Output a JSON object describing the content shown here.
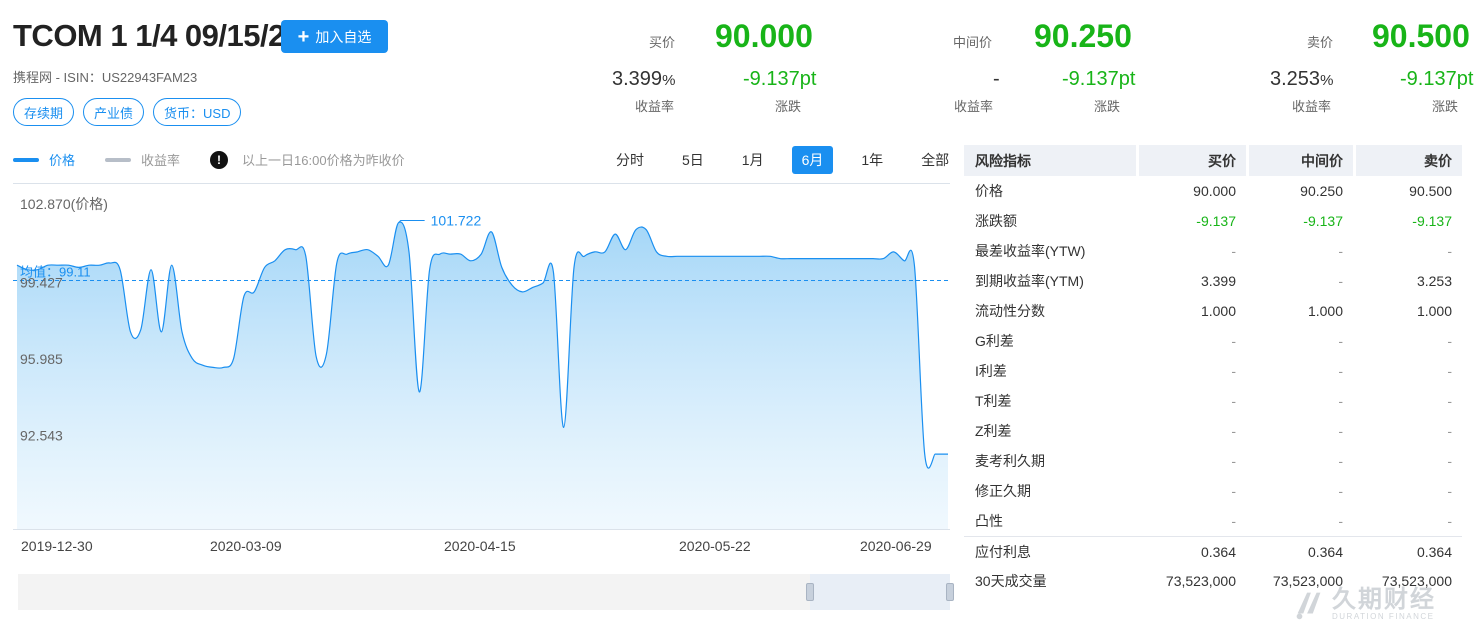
{
  "bond": {
    "title": "TCOM 1 1/4 09/15/22",
    "issuer_line": "携程网 - ISIN：US22943FAM23",
    "tags": [
      "存续期",
      "产业债",
      "货币：USD"
    ]
  },
  "watchlist_label": "加入自选",
  "quotes": {
    "bid": {
      "label": "买价",
      "price": "90.000",
      "yield": "3.399",
      "yield_unit": "%",
      "change": "-9.137pt",
      "yield_label": "收益率",
      "change_label": "涨跌"
    },
    "mid": {
      "label": "中间价",
      "price": "90.250",
      "yield": "-",
      "yield_unit": "",
      "change": "-9.137pt",
      "yield_label": "收益率",
      "change_label": "涨跌"
    },
    "ask": {
      "label": "卖价",
      "price": "90.500",
      "yield": "3.253",
      "yield_unit": "%",
      "change": "-9.137pt",
      "yield_label": "收益率",
      "change_label": "涨跌"
    }
  },
  "legend": {
    "price": "价格",
    "yield": "收益率",
    "info_symbol": "!",
    "note": "以上一日16:00价格为昨收价",
    "price_color": "#1a8ff0",
    "yield_color": "#b7bec8"
  },
  "periods": [
    "分时",
    "5日",
    "1月",
    "6月",
    "1年",
    "全部"
  ],
  "active_period": "6月",
  "chart_data": {
    "type": "area",
    "y_axis_label": "102.870(价格)",
    "y_ticks": [
      "99.427",
      "95.985",
      "92.543"
    ],
    "ylim": [
      89.1,
      102.87
    ],
    "x_ticks": [
      "2019-12-30",
      "2020-03-09",
      "2020-04-15",
      "2020-05-22",
      "2020-06-29"
    ],
    "average_label": "均值：99.11",
    "average": 99.11,
    "max_label": "101.722",
    "max": 101.722,
    "series": [
      {
        "values": [
          99.8,
          99.6,
          99.6,
          99.8,
          99.8,
          99.8,
          99.7,
          99.8,
          99.8,
          99.9,
          99.6,
          96.8,
          96.9,
          99.6,
          96.8,
          99.8,
          96.8,
          95.6,
          95.3,
          95.2,
          95.2,
          95.6,
          98.4,
          98.6,
          99.7,
          100.0,
          100.5,
          100.5,
          100.2,
          95.7,
          95.8,
          99.9,
          100.3,
          100.4,
          100.5,
          100.2,
          99.8,
          101.72,
          100.4,
          94.1,
          99.6,
          100.3,
          100.3,
          100.3,
          100.0,
          100.3,
          101.3,
          99.7,
          98.9,
          98.6,
          98.8,
          99.0,
          99.5,
          92.5,
          99.7,
          100.2,
          100.4,
          100.4,
          101.2,
          100.5,
          101.4,
          101.4,
          100.4,
          100.2,
          100.2,
          100.2,
          100.2,
          100.2,
          100.2,
          100.2,
          100.2,
          100.2,
          100.2,
          100.2,
          100.1,
          100.1,
          100.1,
          100.1,
          100.1,
          100.1,
          100.1,
          100.1,
          100.1,
          100.1,
          100.1,
          100.4,
          100.0,
          99.8,
          91.3,
          91.3
        ]
      }
    ],
    "grid": false
  },
  "risk_table": {
    "headers": [
      "风险指标",
      "买价",
      "中间价",
      "卖价"
    ],
    "rows": [
      [
        "价格",
        "90.000",
        "90.250",
        "90.500"
      ],
      [
        "涨跌额",
        "-9.137",
        "-9.137",
        "-9.137"
      ],
      [
        "最差收益率(YTW)",
        "-",
        "-",
        "-"
      ],
      [
        "到期收益率(YTM)",
        "3.399",
        "-",
        "3.253"
      ],
      [
        "流动性分数",
        "1.000",
        "1.000",
        "1.000"
      ],
      [
        "G利差",
        "-",
        "-",
        "-"
      ],
      [
        "I利差",
        "-",
        "-",
        "-"
      ],
      [
        "T利差",
        "-",
        "-",
        "-"
      ],
      [
        "Z利差",
        "-",
        "-",
        "-"
      ],
      [
        "麦考利久期",
        "-",
        "-",
        "-"
      ],
      [
        "修正久期",
        "-",
        "-",
        "-"
      ],
      [
        "凸性",
        "-",
        "-",
        "-"
      ],
      [
        "应付利息",
        "0.364",
        "0.364",
        "0.364"
      ],
      [
        "30天成交量",
        "73,523,000",
        "73,523,000",
        "73,523,000"
      ]
    ]
  },
  "watermark": {
    "cn": "久期财经",
    "en": "DURATION FINANCE"
  },
  "colors": {
    "accent": "#1a8ff0",
    "negative": "#18b418"
  }
}
